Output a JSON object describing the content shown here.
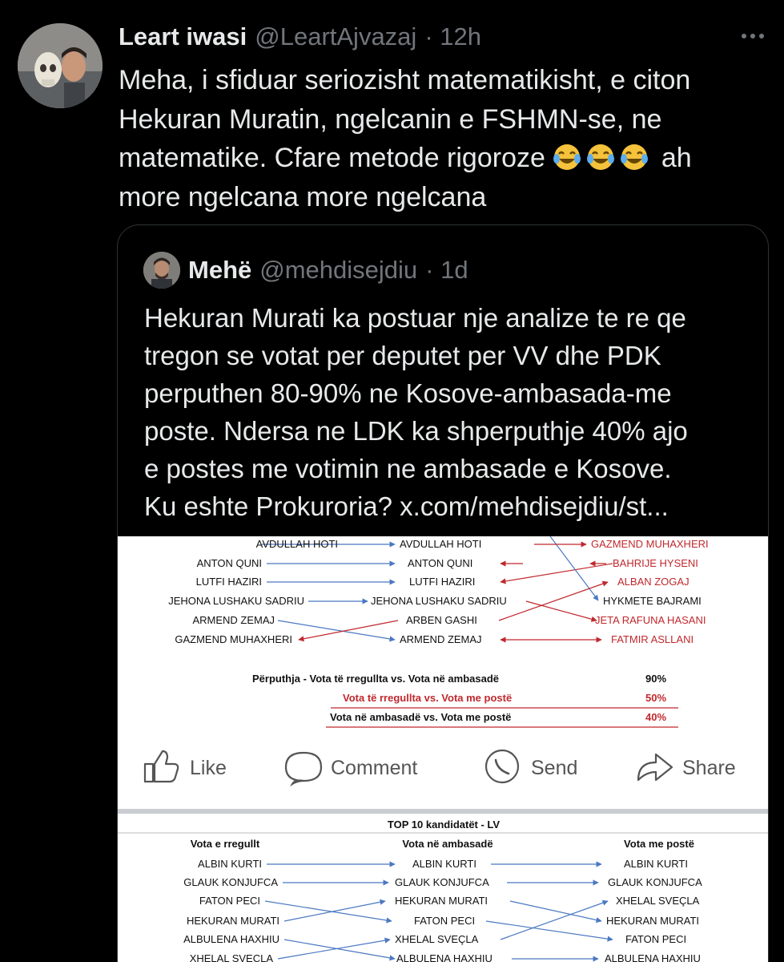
{
  "tweet": {
    "author_name": "Leart iwasi",
    "author_handle": "@LeartAjvazaj",
    "time": "· 12h",
    "text_lines": [
      "Meha, i sfiduar seriozisht matematikisht, e citon",
      "Hekuran Muratin, ngelcanin e FSHMN-se, ne",
      "matematike. Cfare metode rigoroze",
      "ah",
      "more ngelcana more ngelcana"
    ],
    "emoji": "face-with-tears-of-joy x3",
    "more_icon": "more-horizontal-icon"
  },
  "quote": {
    "author_name": "Mehë",
    "author_handle": "@mehdisejdiu",
    "time": "· 1d",
    "text_lines": [
      "Hekuran Murati ka postuar nje analize te re qe",
      "tregon se votat per deputet per VV dhe PDK",
      "perputhen 80-90% ne Kosove-ambasada-me",
      "poste. Ndersa ne LDK ka shperputhje 40% ajo",
      "e postes me votimin ne ambasade e Kosove.",
      "Ku eshte Prokuroria? x.com/mehdisejdiu/st..."
    ]
  },
  "image": {
    "top_col1": [
      "AVDULLAH HOTI",
      "ANTON QUNI",
      "LUTFI HAZIRI",
      "JEHONA LUSHAKU SADRIU",
      "ARMEND ZEMAJ",
      "GAZMEND MUHAXHERI"
    ],
    "top_col2": [
      "AVDULLAH HOTI",
      "ANTON QUNI",
      "LUTFI HAZIRI",
      "JEHONA LUSHAKU SADRIU",
      "ARBEN GASHI",
      "ARMEND ZEMAJ"
    ],
    "top_col3": [
      "GAZMEND MUHAXHERI",
      "BAHRIJE HYSENI",
      "ALBAN ZOGAJ",
      "HYKMETE BAJRAMI",
      "JETA RAFUNA HASANI",
      "FATMIR ASLLANI"
    ],
    "match_rows": [
      {
        "label": "Përputhja - Vota të rregullta vs. Vota në ambasadë",
        "value": "90%"
      },
      {
        "label": "Vota të rregullta vs. Vota me postë",
        "value": "50%"
      },
      {
        "label": "Vota në ambasadë vs. Vota me postë",
        "value": "40%"
      }
    ],
    "actions": [
      "Like",
      "Comment",
      "Send",
      "Share"
    ],
    "table_title": "TOP 10 kandidatët - LV",
    "col_headers": [
      "Vota e rregullt",
      "Vota në ambasadë",
      "Vota me postë"
    ],
    "bottom_col1": [
      "ALBIN KURTI",
      "GLAUK KONJUFCA",
      "FATON PECI",
      "HEKURAN MURATI",
      "ALBULENA HAXHIU",
      "XHELAL SVEÇLA"
    ],
    "bottom_col2": [
      "ALBIN KURTI",
      "GLAUK KONJUFCA",
      "HEKURAN MURATI",
      "FATON PECI",
      "XHELAL SVEÇLA",
      "ALBULENA HAXHIU"
    ],
    "bottom_col3": [
      "ALBIN KURTI",
      "GLAUK KONJUFCA",
      "XHELAL SVEÇLA",
      "HEKURAN MURATI",
      "FATON PECI",
      "ALBULENA HAXHIU"
    ],
    "colors": {
      "blue_arrow": "#4a78c2",
      "red_arrow": "#c0282d",
      "red_text": "#c0282d"
    }
  }
}
